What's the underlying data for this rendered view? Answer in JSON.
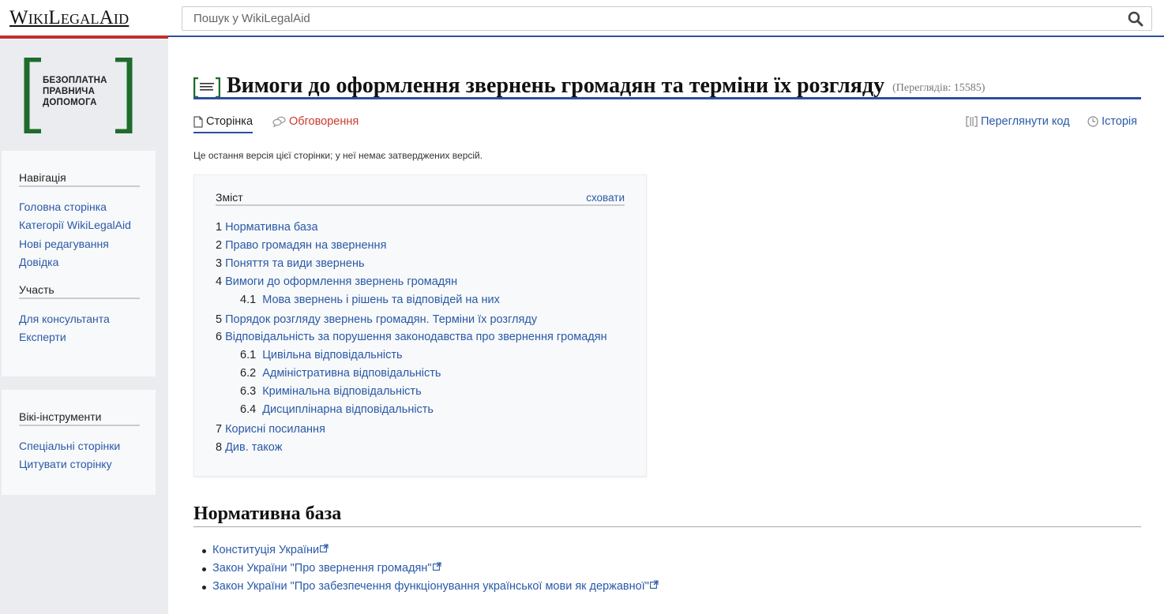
{
  "header": {
    "brand": "WikiLegalAid",
    "search_placeholder": "Пошук у WikiLegalAid"
  },
  "colors": {
    "brand_red": "#c0312b",
    "accent_blue": "#2c4f9e",
    "link": "#2a59a8",
    "talk_red": "#c93a2e",
    "logo_green": "#1f6b2b"
  },
  "logo": {
    "lines": [
      "БЕЗОПЛАТНА",
      "ПРАВНИЧА",
      "ДОПОМОГА"
    ]
  },
  "sidebar": {
    "sections": [
      {
        "title": "Навігація",
        "items": [
          "Головна сторінка",
          "Категорії WikiLegalAid",
          "Нові редагування",
          "Довідка"
        ]
      },
      {
        "title": "Участь",
        "items": [
          "Для консультанта",
          "Експерти"
        ]
      },
      {
        "title": "Вікі-інструменти",
        "items": [
          "Спеціальні сторінки",
          "Цитувати сторінку"
        ]
      }
    ]
  },
  "page": {
    "title": "Вимоги до оформлення звернень громадян та терміни їх розгляду",
    "views": "(Переглядів: 15585)",
    "revision_note": "Це остання версія цієї сторінки; у неї немає затверджених версій."
  },
  "tabs": {
    "page": "Сторінка",
    "talk": "Обговорення",
    "view_source": "Переглянути код",
    "history": "Історія"
  },
  "toc": {
    "title": "Зміст",
    "hide": "сховати",
    "items": [
      {
        "num": "1",
        "label": "Нормативна база"
      },
      {
        "num": "2",
        "label": "Право громадян на звернення"
      },
      {
        "num": "3",
        "label": "Поняття та види звернень"
      },
      {
        "num": "4",
        "label": "Вимоги до оформлення звернень громадян"
      },
      {
        "num": "4.1",
        "label": "Мова звернень і рішень та відповідей на них"
      },
      {
        "num": "5",
        "label": "Порядок розгляду звернень громадян. Терміни їх розгляду"
      },
      {
        "num": "6",
        "label": "Відповідальність за порушення законодавства про звернення громадян"
      },
      {
        "num": "6.1",
        "label": "Цивільна відповідальність"
      },
      {
        "num": "6.2",
        "label": "Адміністративна відповідальність"
      },
      {
        "num": "6.3",
        "label": "Кримінальна відповідальність"
      },
      {
        "num": "6.4",
        "label": "Дисциплінарна відповідальність"
      },
      {
        "num": "7",
        "label": "Корисні посилання"
      },
      {
        "num": "8",
        "label": "Див. також"
      }
    ]
  },
  "section": {
    "heading": "Нормативна база",
    "links": [
      "Конституція України",
      "Закон України \"Про звернення громадян\"",
      "Закон України \"Про забезпечення функціонування української мови як державної\""
    ]
  }
}
